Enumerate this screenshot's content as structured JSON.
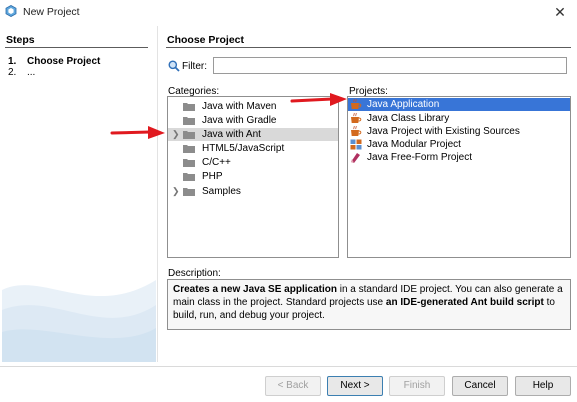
{
  "window": {
    "title": "New Project",
    "close_glyph": "✕"
  },
  "steps": {
    "heading": "Steps",
    "items": [
      {
        "num": "1.",
        "label": "Choose Project"
      },
      {
        "num": "2.",
        "label": "..."
      }
    ]
  },
  "main": {
    "heading": "Choose Project",
    "filter": {
      "label": "Filter:",
      "value": "",
      "placeholder": ""
    },
    "categories": {
      "label": "Categories:",
      "items": [
        {
          "label": "Java with Maven",
          "expandable": false,
          "selected": false
        },
        {
          "label": "Java with Gradle",
          "expandable": false,
          "selected": false
        },
        {
          "label": "Java with Ant",
          "expandable": true,
          "selected": true
        },
        {
          "label": "HTML5/JavaScript",
          "expandable": false,
          "selected": false
        },
        {
          "label": "C/C++",
          "expandable": false,
          "selected": false
        },
        {
          "label": "PHP",
          "expandable": false,
          "selected": false
        },
        {
          "label": "Samples",
          "expandable": true,
          "selected": false
        }
      ]
    },
    "projects": {
      "label": "Projects:",
      "items": [
        {
          "label": "Java Application",
          "icon": "java-cup-icon",
          "selected": true
        },
        {
          "label": "Java Class Library",
          "icon": "java-cup-icon",
          "selected": false
        },
        {
          "label": "Java Project with Existing Sources",
          "icon": "java-cup-icon",
          "selected": false
        },
        {
          "label": "Java Modular Project",
          "icon": "java-modular-icon",
          "selected": false
        },
        {
          "label": "Java Free-Form Project",
          "icon": "java-freeform-icon",
          "selected": false
        }
      ]
    },
    "description": {
      "label": "Description:",
      "p1_bold": "Creates a new Java SE application",
      "p1_rest": " in a standard IDE project. You can also generate a main class in the project. Standard projects use ",
      "p2_bold": "an IDE-generated Ant build script",
      "p2_rest": " to build, run, and debug your project."
    }
  },
  "footer": {
    "back": "< Back",
    "next": "Next >",
    "finish": "Finish",
    "cancel": "Cancel",
    "help": "Help"
  },
  "colors": {
    "selection_blue": "#3875d7",
    "selection_gray": "#d9d9d9",
    "arrow_red": "#e0191f",
    "folder_gray": "#8c8c8c"
  }
}
